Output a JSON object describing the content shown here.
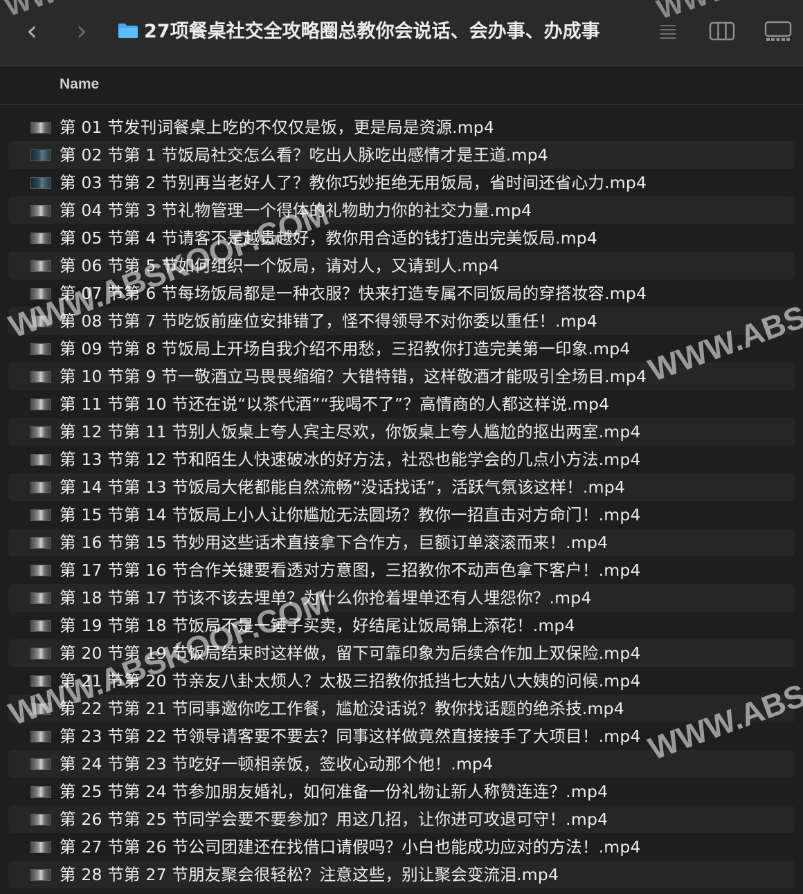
{
  "toolbar": {
    "back_glyph": "‹",
    "forward_glyph": "›",
    "title": "27项餐桌社交全攻略圈总教你会说话、会办事、办成事",
    "folder_icon": "folder-icon",
    "list_view_icon": "list-view-icon",
    "column_view_icon": "column-view-icon",
    "gallery_view_icon": "gallery-view-icon"
  },
  "columns": {
    "name_label": "Name"
  },
  "files": [
    {
      "name": "第 01 节发刊词餐桌上吃的不仅仅是饭，更是局是资源.mp4"
    },
    {
      "name": "第 02 节第 1 节饭局社交怎么看？吃出人脉吃出感情才是王道.mp4"
    },
    {
      "name": "第 03 节第 2 节别再当老好人了？教你巧妙拒绝无用饭局，省时间还省心力.mp4"
    },
    {
      "name": "第 04 节第 3 节礼物管理一个得体的礼物助力你的社交力量.mp4"
    },
    {
      "name": "第 05 节第 4 节请客不是越贵越好，教你用合适的钱打造出完美饭局.mp4"
    },
    {
      "name": "第 06 节第 5 节如何组织一个饭局，请对人，又请到人.mp4"
    },
    {
      "name": "第 07 节第 6 节每场饭局都是一种衣服？快来打造专属不同饭局的穿搭妆容.mp4"
    },
    {
      "name": "第 08 节第 7 节吃饭前座位安排错了，怪不得领导不对你委以重任！.mp4"
    },
    {
      "name": "第 09 节第 8 节饭局上开场自我介绍不用愁，三招教你打造完美第一印象.mp4"
    },
    {
      "name": "第 10 节第 9 节一敬酒立马畏畏缩缩？大错特错，这样敬酒才能吸引全场目.mp4"
    },
    {
      "name": "第 11 节第 10 节还在说“以茶代酒”“我喝不了”？高情商的人都这样说.mp4"
    },
    {
      "name": "第 12 节第 11 节别人饭桌上夸人宾主尽欢，你饭桌上夸人尴尬的抠出两室.mp4"
    },
    {
      "name": "第 13 节第 12 节和陌生人快速破冰的好方法，社恐也能学会的几点小方法.mp4"
    },
    {
      "name": "第 14 节第 13 节饭局大佬都能自然流畅“没话找话”，活跃气氛该这样！.mp4"
    },
    {
      "name": "第 15 节第 14 节饭局上小人让你尴尬无法圆场？教你一招直击对方命门！.mp4"
    },
    {
      "name": "第 16 节第 15 节妙用这些话术直接拿下合作方，巨额订单滚滚而来！.mp4"
    },
    {
      "name": "第 17 节第 16 节合作关键要看透对方意图，三招教你不动声色拿下客户！.mp4"
    },
    {
      "name": "第 18 节第 17 节该不该去埋单？为什么你抢着埋单还有人埋怨你？.mp4"
    },
    {
      "name": "第 19 节第 18 节饭局不是一锤子买卖，好结尾让饭局锦上添花！.mp4"
    },
    {
      "name": "第 20 节第 19 节饭局结束时这样做，留下可靠印象为后续合作加上双保险.mp4"
    },
    {
      "name": "第 21 节第 20 节亲友八卦太烦人？太极三招教你抵挡七大姑八大姨的问候.mp4"
    },
    {
      "name": "第 22 节第 21 节同事邀你吃工作餐，尴尬没话说？教你找话题的绝杀技.mp4"
    },
    {
      "name": "第 23 节第 22 节领导请客要不要去？同事这样做竟然直接接手了大项目！.mp4"
    },
    {
      "name": "第 24 节第 23 节吃好一顿相亲饭，签收心动那个他！.mp4"
    },
    {
      "name": "第 25 节第 24 节参加朋友婚礼，如何准备一份礼物让新人称赞连连？.mp4"
    },
    {
      "name": "第 26 节第 25 节同学会要不要参加？用这几招，让你进可攻退可守！.mp4"
    },
    {
      "name": "第 27 节第 26 节公司团建还在找借口请假吗？小白也能成功应对的方法！.mp4"
    },
    {
      "name": "第 28 节第 27 节朋友聚会很轻松？注意这些，别让聚会变流泪.mp4"
    }
  ],
  "watermarks": {
    "top_left": "WWW",
    "top_right": "WWW",
    "mid_left": "WWW.ABSKOOP.COM",
    "mid_right": "WWW.ABS",
    "low_left": "WWW.ABSKOOP.COM",
    "low_right": "WWW.ABS"
  },
  "colors": {
    "background": "#1e1e1e",
    "toolbar": "#2a2a2a",
    "alt_row": "#262626",
    "folder_accent": "#3fa9f5",
    "text": "#ececec"
  }
}
